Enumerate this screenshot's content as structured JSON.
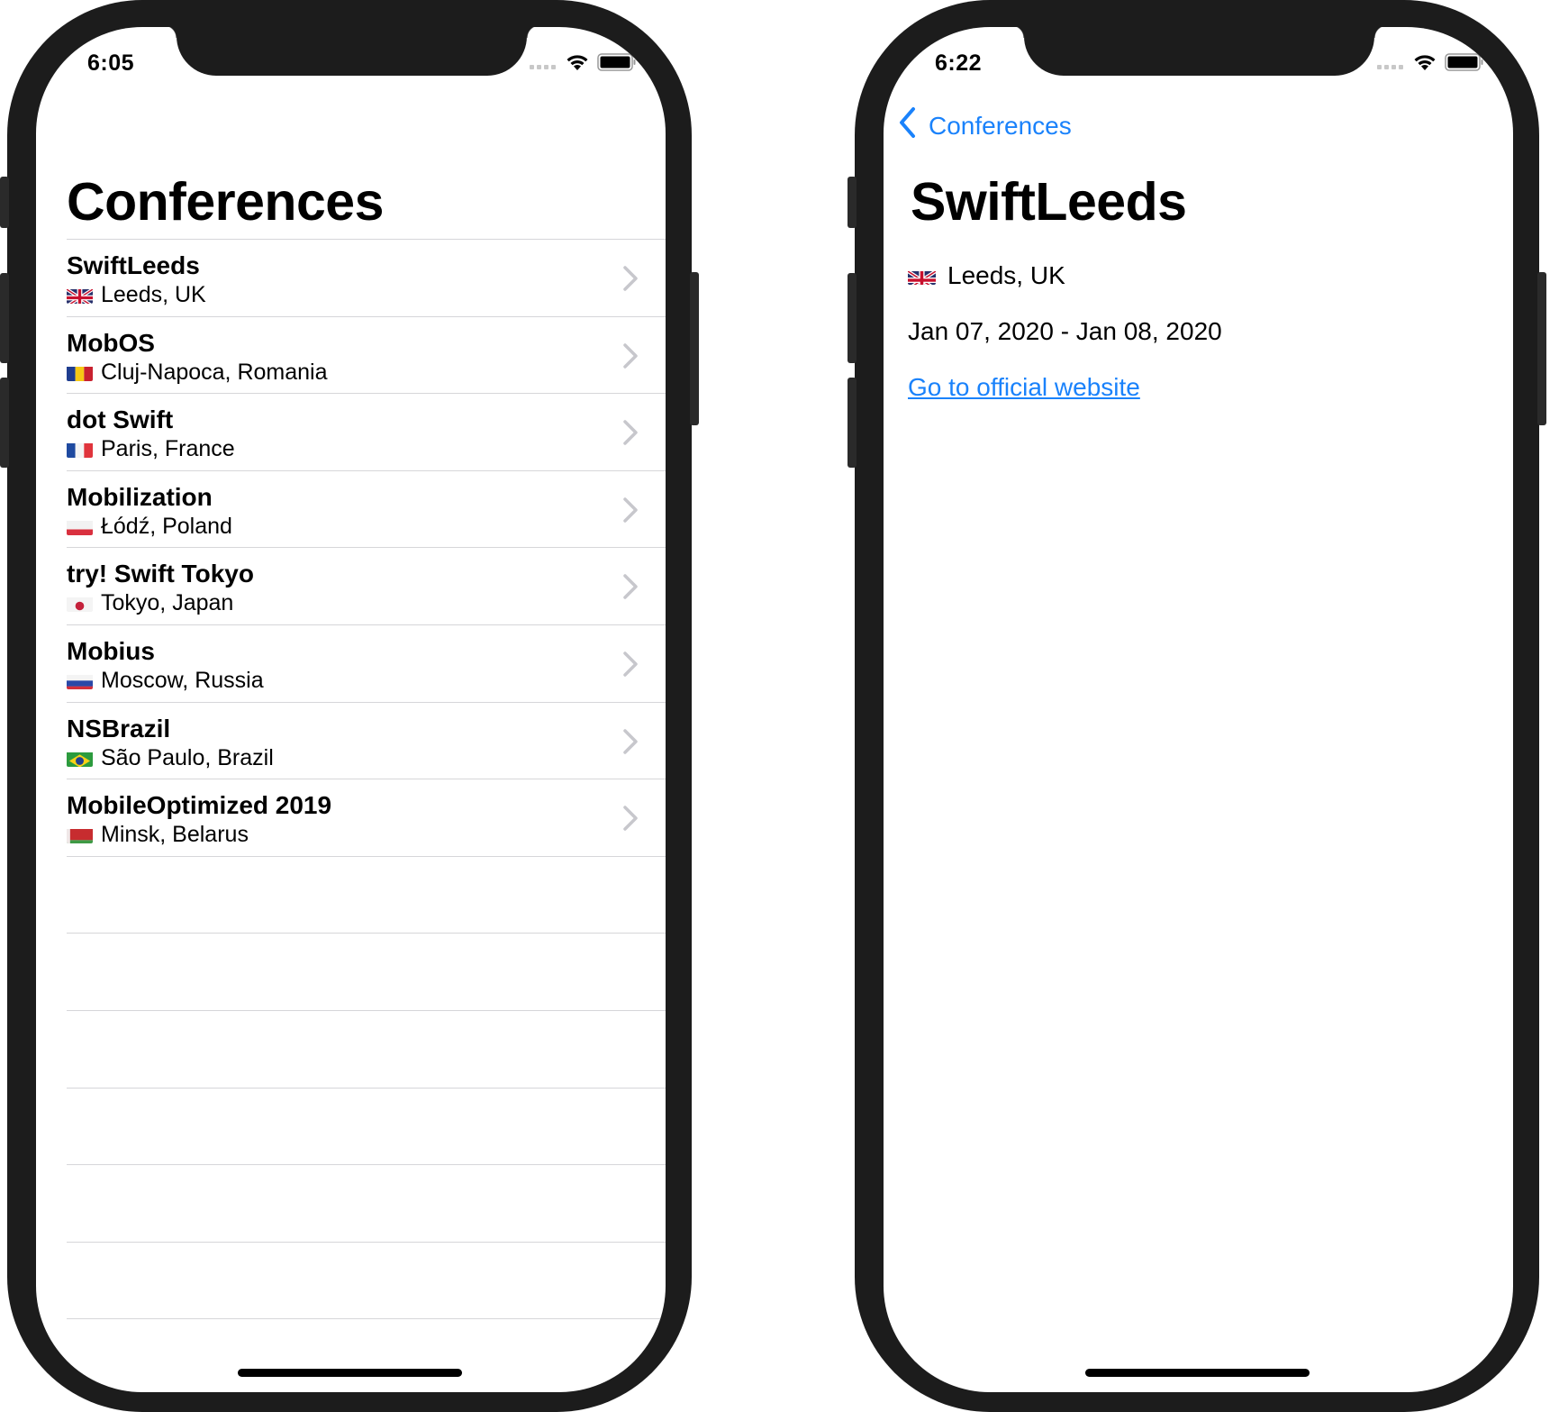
{
  "accent_color": "#1a82fb",
  "list_screen": {
    "status": {
      "time": "6:05"
    },
    "title": "Conferences",
    "conferences": [
      {
        "name": "SwiftLeeds",
        "location": "Leeds, UK",
        "flag": "gb",
        "flag_emoji": "🇬🇧"
      },
      {
        "name": "MobOS",
        "location": "Cluj-Napoca, Romania",
        "flag": "ro",
        "flag_emoji": "🇷🇴"
      },
      {
        "name": "dot Swift",
        "location": "Paris, France",
        "flag": "fr",
        "flag_emoji": "🇫🇷"
      },
      {
        "name": "Mobilization",
        "location": "Łódź, Poland",
        "flag": "pl",
        "flag_emoji": "🇵🇱"
      },
      {
        "name": "try! Swift Tokyo",
        "location": "Tokyo, Japan",
        "flag": "jp",
        "flag_emoji": "🇯🇵"
      },
      {
        "name": "Mobius",
        "location": "Moscow, Russia",
        "flag": "ru",
        "flag_emoji": "🇷🇺"
      },
      {
        "name": "NSBrazil",
        "location": "São Paulo, Brazil",
        "flag": "br",
        "flag_emoji": "🇧🇷"
      },
      {
        "name": "MobileOptimized 2019",
        "location": "Minsk, Belarus",
        "flag": "by",
        "flag_emoji": "🇧🇾"
      }
    ],
    "row_icon": "chevron-right-icon"
  },
  "detail_screen": {
    "status": {
      "time": "6:22"
    },
    "back_label": "Conferences",
    "back_icon": "chevron-left-icon",
    "title": "SwiftLeeds",
    "location": "Leeds, UK",
    "flag": "gb",
    "flag_emoji": "🇬🇧",
    "dates": "Jan 07, 2020 - Jan 08, 2020",
    "link_label": "Go to official website"
  }
}
